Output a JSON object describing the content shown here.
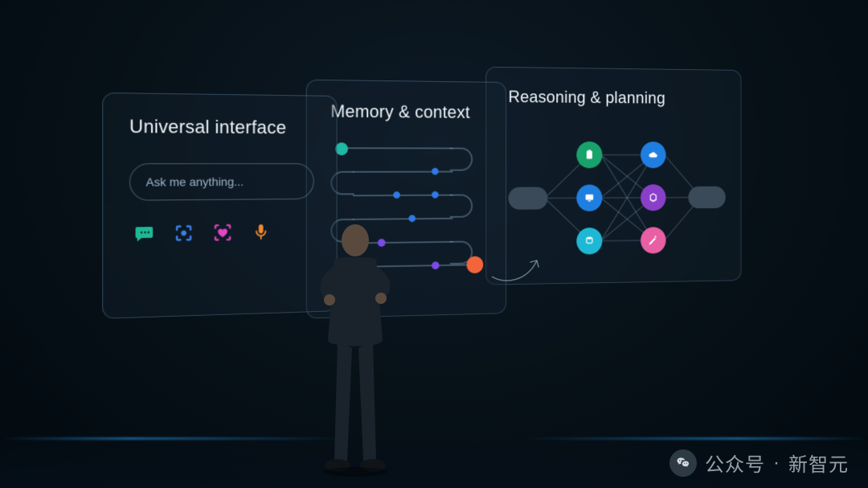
{
  "panels": {
    "p1": {
      "title": "Universal interface",
      "placeholder": "Ask me anything..."
    },
    "p2": {
      "title": "Memory & context"
    },
    "p3": {
      "title": "Reasoning & planning"
    }
  },
  "icons": {
    "chat": "chat-bubble-icon",
    "scan": "scan-frame-icon",
    "heart_shield": "heart-brackets-icon",
    "mic": "microphone-icon"
  },
  "memory_dots": [
    {
      "color": "#1fb8a5"
    },
    {
      "color": "#2e7ae6"
    },
    {
      "color": "#2e7ae6"
    },
    {
      "color": "#2e7ae6"
    },
    {
      "color": "#2e7ae6"
    },
    {
      "color": "#7a4ae6"
    },
    {
      "color": "#7a4ae6"
    },
    {
      "color": "#f2653a"
    }
  ],
  "reasoning_nodes": {
    "left_column": [
      {
        "color": "#17a36b",
        "glyph": "clipboard"
      },
      {
        "color": "#1f7fe0",
        "glyph": "monitor"
      },
      {
        "color": "#1fb8d4",
        "glyph": "database"
      }
    ],
    "right_column": [
      {
        "color": "#1f7fe0",
        "glyph": "cloud"
      },
      {
        "color": "#8a3fc9",
        "glyph": "cube"
      },
      {
        "color": "#e85fa3",
        "glyph": "pen"
      }
    ]
  },
  "watermark": {
    "label": "公众号",
    "sep": "·",
    "name": "新智元"
  }
}
